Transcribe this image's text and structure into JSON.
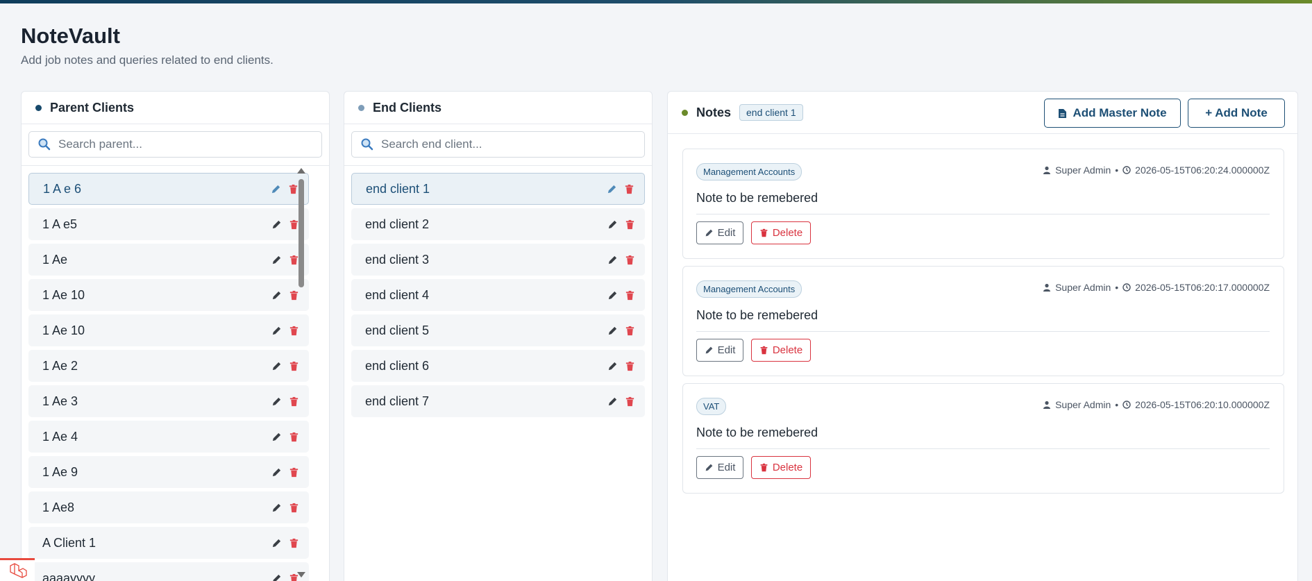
{
  "app": {
    "title": "NoteVault",
    "subtitle": "Add job notes and queries related to end clients."
  },
  "parent_panel": {
    "title": "Parent Clients",
    "search_placeholder": "Search parent...",
    "items": [
      {
        "label": "1 A e 6",
        "selected": true
      },
      {
        "label": "1 A e5"
      },
      {
        "label": "1 Ae"
      },
      {
        "label": "1 Ae 10"
      },
      {
        "label": "1 Ae 10"
      },
      {
        "label": "1 Ae 2"
      },
      {
        "label": "1 Ae 3"
      },
      {
        "label": "1 Ae 4"
      },
      {
        "label": "1 Ae 9"
      },
      {
        "label": "1 Ae8"
      },
      {
        "label": "A Client 1"
      },
      {
        "label": "aaaayyyy"
      }
    ]
  },
  "end_panel": {
    "title": "End Clients",
    "search_placeholder": "Search end client...",
    "items": [
      {
        "label": "end client 1",
        "selected": true
      },
      {
        "label": "end client 2"
      },
      {
        "label": "end client 3"
      },
      {
        "label": "end client 4"
      },
      {
        "label": "end client 5"
      },
      {
        "label": "end client 6"
      },
      {
        "label": "end client 7"
      }
    ]
  },
  "notes_panel": {
    "title": "Notes",
    "client_badge": "end client 1",
    "add_master_label": "Add Master Note",
    "add_note_label": "+ Add Note",
    "notes": [
      {
        "tag": "Management Accounts",
        "author": "Super Admin",
        "timestamp": "2026-05-15T06:20:24.000000Z",
        "text": "Note to be remebered",
        "edit_label": "Edit",
        "delete_label": "Delete"
      },
      {
        "tag": "Management Accounts",
        "author": "Super Admin",
        "timestamp": "2026-05-15T06:20:17.000000Z",
        "text": "Note to be remebered",
        "edit_label": "Edit",
        "delete_label": "Delete"
      },
      {
        "tag": "VAT",
        "author": "Super Admin",
        "timestamp": "2026-05-15T06:20:10.000000Z",
        "text": "Note to be remebered",
        "edit_label": "Edit",
        "delete_label": "Delete"
      }
    ]
  },
  "icons": {
    "search": "search-icon",
    "edit": "pencil-icon",
    "delete": "trash-icon",
    "user": "user-icon",
    "clock": "clock-icon",
    "file": "file-icon"
  },
  "colors": {
    "primary": "#1d4f75",
    "danger": "#d9333f",
    "accent_green": "#6b8a2a"
  }
}
